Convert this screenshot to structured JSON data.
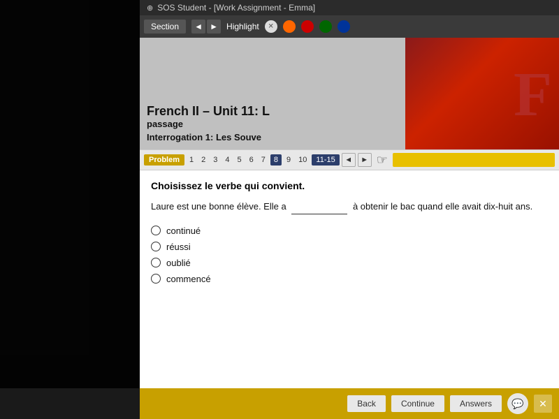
{
  "titlebar": {
    "title": "SOS Student - [Work Assignment - Emma]",
    "icon": "sos-icon"
  },
  "toolbar": {
    "section_label": "Section",
    "nav_prev": "◄",
    "nav_next": "►",
    "highlight_label": "Highlight",
    "colors": [
      "#e0e0e0",
      "#ff6600",
      "#cc0000",
      "#006600",
      "#003399"
    ],
    "color_names": [
      "eraser",
      "orange",
      "red",
      "green",
      "blue"
    ]
  },
  "image": {
    "course_title": "French II – Unit 11: L",
    "course_subtitle": "passage",
    "section_label": "Interrogation 1: Les Souve"
  },
  "problem_nav": {
    "label": "Problem",
    "pages": [
      "1",
      "2",
      "3",
      "4",
      "5",
      "6",
      "7",
      "8",
      "9",
      "10",
      "11-15"
    ],
    "active_page": "11-15"
  },
  "question": {
    "instruction": "Choisissez le verbe qui convient.",
    "text_before": "Laure est une bonne élève. Elle a",
    "blank": "________",
    "text_after": "à obtenir le bac quand elle avait dix-huit ans.",
    "options": [
      "continué",
      "réussi",
      "oublié",
      "commencé"
    ]
  },
  "bottom_toolbar": {
    "back_label": "Back",
    "continue_label": "Continue",
    "answers_label": "Answers",
    "chat_icon": "💬",
    "close_icon": "✕"
  }
}
